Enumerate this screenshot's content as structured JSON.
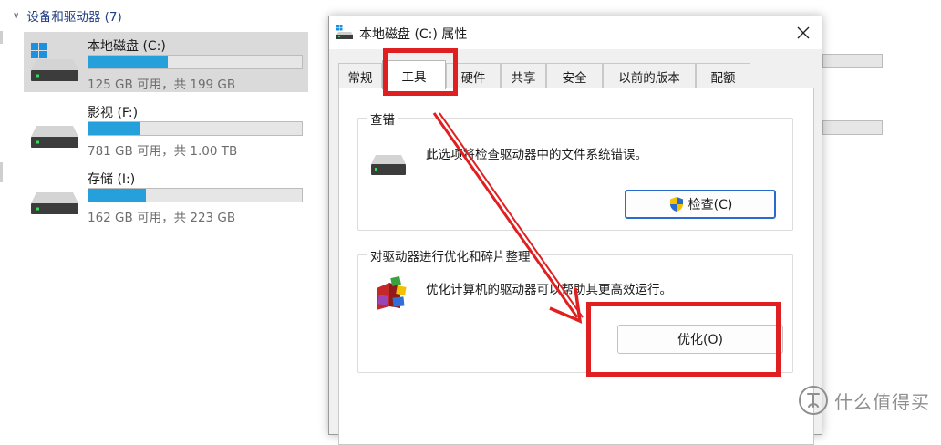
{
  "explorer": {
    "section_title": "设备和驱动器 (7)",
    "drives": [
      {
        "name": "本地磁盘 (C:)",
        "usage": "125 GB 可用，共 199 GB",
        "used_fraction": 0.37,
        "selected": true
      },
      {
        "name": "影视 (F:)",
        "usage": "781 GB 可用，共 1.00 TB",
        "used_fraction": 0.24,
        "selected": false
      },
      {
        "name": "存储 (I:)",
        "usage": "162 GB 可用，共 223 GB",
        "used_fraction": 0.27,
        "selected": false
      }
    ]
  },
  "dialog": {
    "title": "本地磁盘 (C:) 属性",
    "tabs": [
      {
        "label": "常规",
        "active": false
      },
      {
        "label": "工具",
        "active": true
      },
      {
        "label": "硬件",
        "active": false
      },
      {
        "label": "共享",
        "active": false
      },
      {
        "label": "安全",
        "active": false
      },
      {
        "label": "以前的版本",
        "active": false
      },
      {
        "label": "配额",
        "active": false
      }
    ],
    "check_group": {
      "legend": "查错",
      "description": "此选项将检查驱动器中的文件系统错误。",
      "button_label": "检查(C)"
    },
    "optimize_group": {
      "legend": "对驱动器进行优化和碎片整理",
      "description": "优化计算机的驱动器可以帮助其更高效运行。",
      "button_label": "优化(O)"
    }
  },
  "watermark": {
    "text": "什么值得买"
  },
  "colors": {
    "accent_bar": "#26a0da",
    "annotation": "#e02020",
    "selected_tile": "#dadada",
    "header_text": "#1f3d80"
  }
}
